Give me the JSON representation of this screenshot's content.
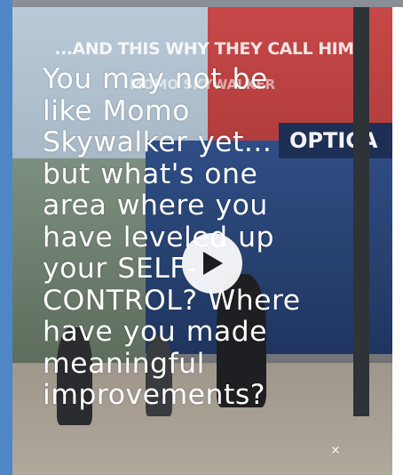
{
  "video": {
    "caption_top": "...AND THIS WHY THEY CALL HIM",
    "caption_sub": "MOMO SKYWALKER",
    "sign_text": "OPTICA"
  },
  "overlay": {
    "lines": [
      "You may not be",
      "like Momo",
      "Skywalker yet...",
      "but what's one",
      "area where you",
      "have leveled up",
      "your SELF-",
      "CONTROL? Where",
      "have you made",
      "meaningful",
      "improvements?"
    ]
  },
  "controls": {
    "play_icon": "play-icon",
    "close_symbol": "×"
  },
  "colors": {
    "left_strip": "#4f86c6",
    "overlay_text": "#ffffff",
    "play_button_bg": "#ffffff"
  }
}
